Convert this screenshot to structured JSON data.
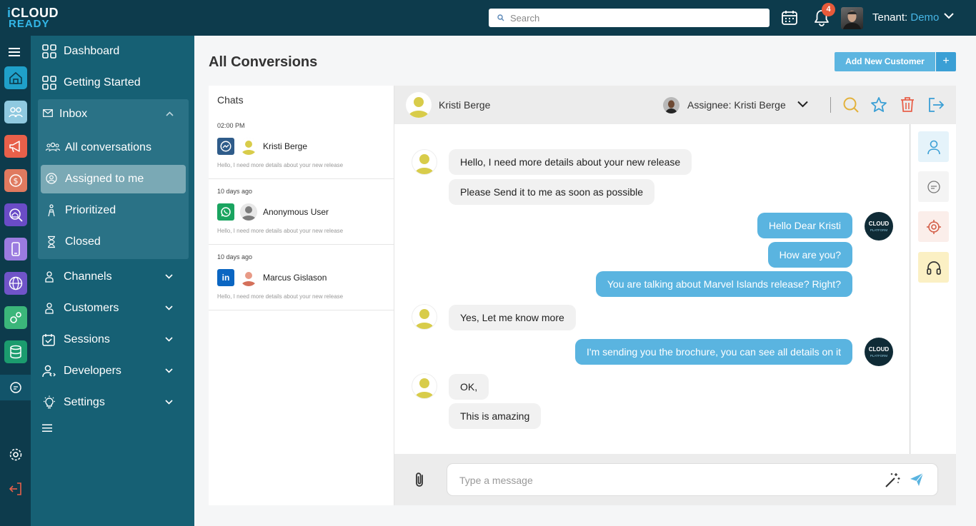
{
  "brand": {
    "logo_line1": "CLOUD",
    "logo_i": "i",
    "logo_line2": "READY",
    "avatar_text_top": "CLOUD",
    "avatar_text_sub": "PLATFORM"
  },
  "topbar": {
    "search_placeholder": "Search",
    "notifications_count": "4",
    "tenant_label": "Tenant: ",
    "tenant_value": "Demo"
  },
  "rail": {
    "icons": [
      "menu-icon",
      "home-icon",
      "team-icon",
      "megaphone-icon",
      "dollar-icon",
      "search-home-icon",
      "mobile-icon",
      "globe-icon",
      "gears-icon",
      "database-icon",
      "chat-icon",
      "gear-icon",
      "logout-icon"
    ],
    "colors": [
      "#1fa0c9",
      "#8fc9e0",
      "#e8604a",
      "#e07a5f",
      "#6a4cc7",
      "#9b7be0",
      "#7054c9",
      "#3bb67a",
      "#1b9c6e"
    ]
  },
  "sidebar": {
    "dashboard": "Dashboard",
    "getting_started": "Getting Started",
    "inbox": "Inbox",
    "inbox_items": [
      "All conversations",
      "Assigned to me",
      "Prioritized",
      "Closed"
    ],
    "channels": "Channels",
    "customers": "Customers",
    "sessions": "Sessions",
    "developers": "Developers",
    "settings": "Settings"
  },
  "main": {
    "title": "All Conversions",
    "add_customer": "Add New Customer",
    "add_plus": "+"
  },
  "chats": {
    "title": "Chats",
    "items": [
      {
        "time": "02:00 PM",
        "name": "Kristi Berge",
        "preview": "Hello, I need more details about your new release",
        "channel": "messenger-icon",
        "channel_color": "#2f5c8a"
      },
      {
        "time": "10 days ago",
        "name": "Anonymous User",
        "preview": "Hello, I need more details about your new release",
        "channel": "whatsapp-icon",
        "channel_color": "#1aa460"
      },
      {
        "time": "10 days ago",
        "name": "Marcus Gislason",
        "preview": "Hello, I need more details about your new release",
        "channel": "linkedin-icon",
        "channel_color": "#0b66c2"
      }
    ]
  },
  "conversation": {
    "contact_name": "Kristi Berge",
    "assignee": "Assignee: Kristi Berge",
    "messages": [
      {
        "dir": "in",
        "text": "Hello, I need more details about your new release"
      },
      {
        "dir": "in",
        "text": "Please Send it to me as soon as possible"
      },
      {
        "dir": "out",
        "text": "Hello Dear Kristi"
      },
      {
        "dir": "out",
        "text": "How are you?"
      },
      {
        "dir": "out",
        "text": "You are talking about Marvel Islands release? Right?"
      },
      {
        "dir": "in",
        "text": "Yes, Let me know more"
      },
      {
        "dir": "out",
        "text": "I'm sending you the brochure, you can see all details on it"
      },
      {
        "dir": "in",
        "text": "OK,"
      },
      {
        "dir": "in",
        "text": "This is amazing"
      }
    ],
    "composer_placeholder": "Type a message"
  },
  "colors": {
    "accent": "#5ab4e0",
    "sidebar": "#166074",
    "topbar": "#0d3b4c",
    "badge": "#e85a3a",
    "avatar_yellow": "#d8cc4a"
  }
}
